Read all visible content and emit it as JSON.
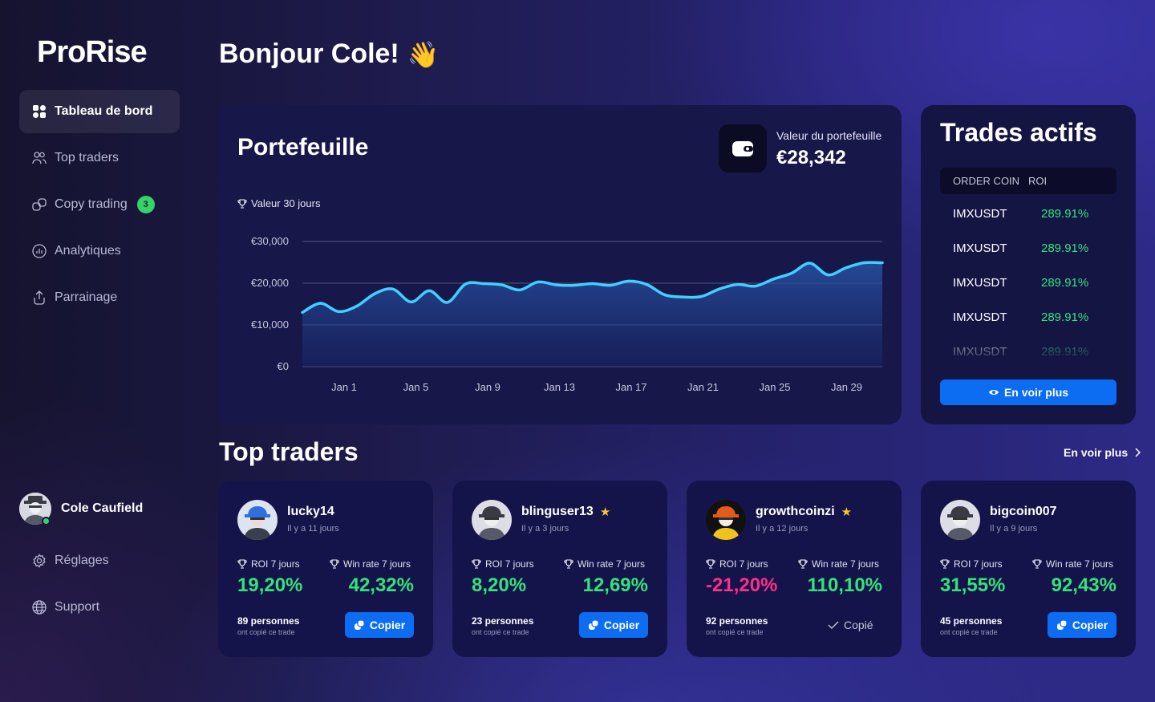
{
  "app": {
    "logo": "ProRise"
  },
  "sidebar": {
    "items": [
      {
        "label": "Tableau de bord",
        "icon": "dashboard-icon"
      },
      {
        "label": "Top traders",
        "icon": "users-icon"
      },
      {
        "label": "Copy trading",
        "icon": "copy-icon",
        "badge": "3"
      },
      {
        "label": "Analytiques",
        "icon": "analytics-icon"
      },
      {
        "label": "Parrainage",
        "icon": "share-icon"
      }
    ],
    "user": {
      "name": "Cole Caufield"
    },
    "bottom": [
      {
        "label": "Réglages",
        "icon": "gear-icon"
      },
      {
        "label": "Support",
        "icon": "globe-icon"
      }
    ]
  },
  "header": {
    "greeting": "Bonjour Cole!",
    "emoji": "👋"
  },
  "portfolio": {
    "title": "Portefeuille",
    "value_label": "Valeur du portefeuille",
    "value": "€28,342",
    "period_label": "Valeur 30 jours"
  },
  "chart_data": {
    "type": "area",
    "y_ticks": [
      "€30,000",
      "€20,000",
      "€10,000",
      "€0"
    ],
    "ylim": [
      0,
      30000
    ],
    "x_ticks": [
      "Jan 1",
      "Jan 5",
      "Jan 9",
      "Jan 13",
      "Jan 17",
      "Jan 21",
      "Jan 25",
      "Jan 29"
    ],
    "x": [
      1,
      2,
      3,
      4,
      5,
      6,
      7,
      8,
      9,
      10,
      11,
      12,
      13,
      14,
      15,
      16,
      17,
      18,
      19,
      20,
      21,
      22,
      23,
      24,
      25,
      26,
      27,
      28,
      29,
      30,
      31,
      32,
      33
    ],
    "values": [
      13000,
      15200,
      13200,
      14500,
      17500,
      18600,
      15500,
      18200,
      15400,
      19800,
      19900,
      19600,
      18400,
      20300,
      19600,
      19500,
      19900,
      19500,
      20500,
      19700,
      17200,
      16700,
      16800,
      18600,
      19700,
      19300,
      21000,
      22400,
      24800,
      22000,
      23700,
      24900,
      24900
    ]
  },
  "trades": {
    "title": "Trades actifs",
    "headers": [
      "ORDER COIN",
      "ROI"
    ],
    "rows": [
      {
        "coin": "IMXUSDT",
        "roi": "289.91%"
      },
      {
        "coin": "IMXUSDT",
        "roi": "289.91%"
      },
      {
        "coin": "IMXUSDT",
        "roi": "289.91%"
      },
      {
        "coin": "IMXUSDT",
        "roi": "289.91%"
      },
      {
        "coin": "IMXUSDT",
        "roi": "289.91%"
      }
    ],
    "more_label": "En voir plus"
  },
  "top_traders": {
    "title": "Top traders",
    "more_label": "En voir plus",
    "roi_label": "ROI 7 jours",
    "winrate_label": "Win rate 7 jours",
    "copied_sub": "ont copié ce trade",
    "copy_label": "Copier",
    "copied_label": "Copié",
    "cards": [
      {
        "name": "lucky14",
        "ago": "Il y a 11 jours",
        "roi": "19,20%",
        "winrate": "42,32%",
        "people": "89 personnes",
        "star": false,
        "copied": false,
        "roi_negative": false
      },
      {
        "name": "blinguser13",
        "ago": "Il y a 3 jours",
        "roi": "8,20%",
        "winrate": "12,69%",
        "people": "23 personnes",
        "star": true,
        "copied": false,
        "roi_negative": false
      },
      {
        "name": "growthcoinzi",
        "ago": "Il y a 12 jours",
        "roi": "-21,20%",
        "winrate": "110,10%",
        "people": "92 personnes",
        "star": true,
        "copied": true,
        "roi_negative": true
      },
      {
        "name": "bigcoin007",
        "ago": "Il y a 9 jours",
        "roi": "31,55%",
        "winrate": "92,43%",
        "people": "45 personnes",
        "star": false,
        "copied": false,
        "roi_negative": false
      }
    ]
  },
  "colors": {
    "accent": "#0c6cf2",
    "positive": "#34e27a",
    "negative": "#ff2e8a",
    "line": "#3fd0ff",
    "badge": "#35d46a"
  }
}
